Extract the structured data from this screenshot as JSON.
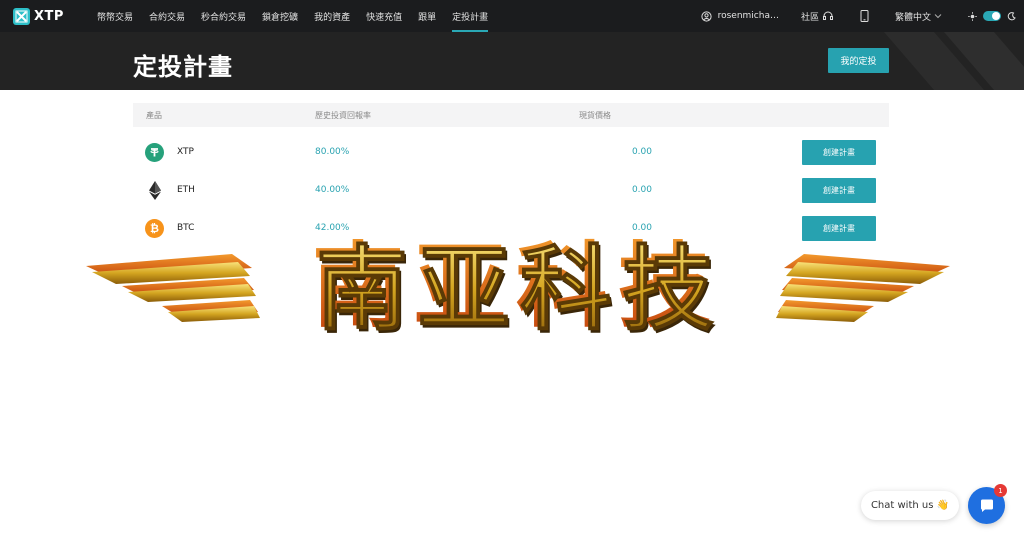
{
  "brand": {
    "name": "XTP"
  },
  "nav": {
    "items": [
      {
        "label": "幣幣交易",
        "active": false
      },
      {
        "label": "合約交易",
        "active": false
      },
      {
        "label": "秒合約交易",
        "active": false
      },
      {
        "label": "鎖倉挖礦",
        "active": false
      },
      {
        "label": "我的資產",
        "active": false
      },
      {
        "label": "快速充值",
        "active": false
      },
      {
        "label": "跟單",
        "active": false
      },
      {
        "label": "定投計畫",
        "active": true
      }
    ],
    "username": "rosenmicha…",
    "community": "社區",
    "language": "繁體中文"
  },
  "hero": {
    "title": "定投計畫",
    "button": "我的定投"
  },
  "table": {
    "headers": {
      "product": "產品",
      "history_return": "歷史投資回報率",
      "price": "現貨價格"
    },
    "rows": [
      {
        "symbol": "XTP",
        "return": "80.00%",
        "price": "0.00",
        "button": "創建計畫",
        "coin_icon": "tether-icon",
        "color": "#26a17b"
      },
      {
        "symbol": "ETH",
        "return": "40.00%",
        "price": "0.00",
        "button": "創建計畫",
        "coin_icon": "ethereum-icon",
        "color": "#2b2b2b"
      },
      {
        "symbol": "BTC",
        "return": "42.00%",
        "price": "0.00",
        "button": "創建計畫",
        "coin_icon": "bitcoin-icon",
        "color": "#f7931a"
      }
    ]
  },
  "watermark": {
    "text": "南亚科技"
  },
  "chat": {
    "label": "Chat with us 👋",
    "badge": "1"
  },
  "colors": {
    "accent": "#27a2b0",
    "nav_bg": "#1b1c1e",
    "hero_bg": "#232323"
  }
}
